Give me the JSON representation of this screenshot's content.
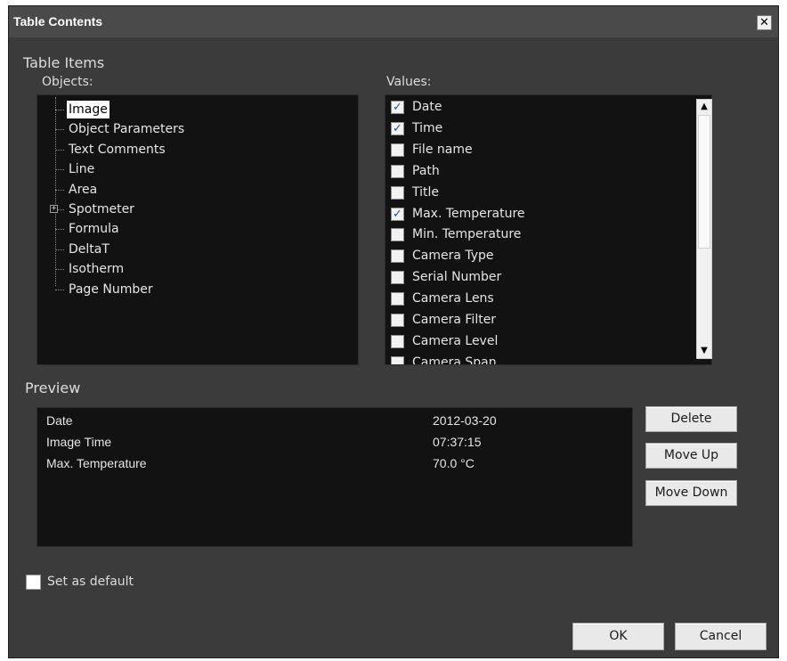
{
  "dialog": {
    "title": "Table Contents",
    "close_symbol": "✕"
  },
  "labels": {
    "table_items": "Table Items",
    "objects": "Objects:",
    "values": "Values:",
    "preview": "Preview",
    "set_default": "Set as default"
  },
  "objects": [
    {
      "label": "Image",
      "selected": true
    },
    {
      "label": "Object Parameters"
    },
    {
      "label": "Text Comments"
    },
    {
      "label": "Line"
    },
    {
      "label": "Area"
    },
    {
      "label": "Spotmeter",
      "expander": "+"
    },
    {
      "label": "Formula"
    },
    {
      "label": "DeltaT"
    },
    {
      "label": "Isotherm"
    },
    {
      "label": "Page Number"
    }
  ],
  "values": [
    {
      "label": "Date",
      "checked": true
    },
    {
      "label": "Time",
      "checked": true
    },
    {
      "label": "File name",
      "checked": false
    },
    {
      "label": "Path",
      "checked": false
    },
    {
      "label": "Title",
      "checked": false
    },
    {
      "label": "Max. Temperature",
      "checked": true
    },
    {
      "label": "Min. Temperature",
      "checked": false
    },
    {
      "label": "Camera Type",
      "checked": false
    },
    {
      "label": "Serial Number",
      "checked": false
    },
    {
      "label": "Camera Lens",
      "checked": false
    },
    {
      "label": "Camera Filter",
      "checked": false
    },
    {
      "label": "Camera Level",
      "checked": false
    },
    {
      "label": "Camera Span",
      "checked": false
    }
  ],
  "preview": [
    {
      "name": "Date",
      "value": "2012-03-20"
    },
    {
      "name": "Image Time",
      "value": "07:37:15"
    },
    {
      "name": "Max. Temperature",
      "value": "70.0 °C"
    }
  ],
  "buttons": {
    "delete": "Delete",
    "move_up": "Move Up",
    "move_down": "Move Down",
    "ok": "OK",
    "cancel": "Cancel"
  },
  "set_default_checked": false,
  "icons": {
    "check": "✓",
    "scroll_up": "▲",
    "scroll_down": "▼"
  }
}
